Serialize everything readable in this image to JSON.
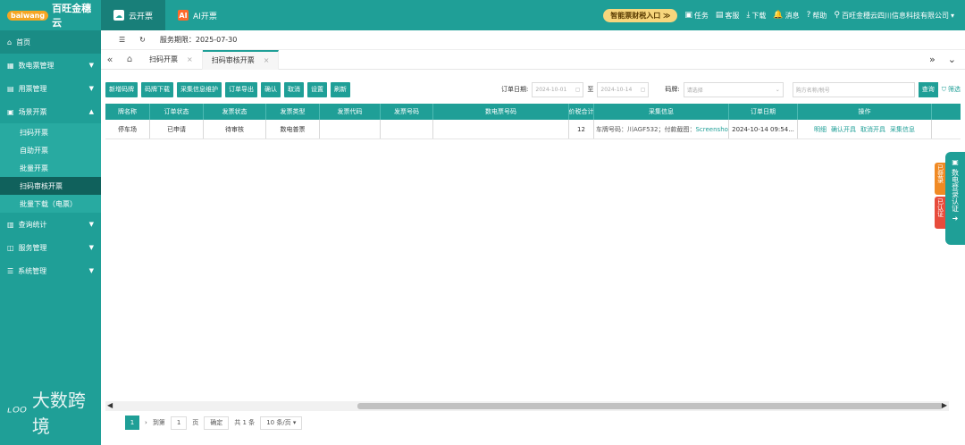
{
  "header": {
    "brand_badge": "baiwang",
    "brand_name": "百旺金穗云",
    "tabs": [
      {
        "label": "云开票"
      },
      {
        "label": "AI开票"
      }
    ],
    "promo": "智能票财税入口 ≫",
    "links": [
      "任务",
      "客服",
      "下载",
      "消息",
      "帮助"
    ],
    "company": "百旺金穗云四川信息科技有限公司"
  },
  "sidebar": {
    "items": [
      {
        "label": "首页"
      },
      {
        "label": "数电票管理"
      },
      {
        "label": "用票管理"
      },
      {
        "label": "场景开票"
      },
      {
        "label": "查询统计"
      },
      {
        "label": "服务管理"
      },
      {
        "label": "系统管理"
      }
    ],
    "sub_items": [
      {
        "label": "扫码开票"
      },
      {
        "label": "自助开票"
      },
      {
        "label": "批量开票"
      },
      {
        "label": "扫码审核开票"
      },
      {
        "label": "批量下载（电票）"
      }
    ],
    "watermark": "大数跨境"
  },
  "service": {
    "label": "服务期限：2025-07-30"
  },
  "page_tabs": [
    {
      "label": "扫码开票"
    },
    {
      "label": "扫码审核开票"
    }
  ],
  "toolbar": {
    "buttons": [
      "新增码牌",
      "码牌下载",
      "采集信息维护",
      "订单导出",
      "确认",
      "取消",
      "设置",
      "刷新"
    ],
    "order_date_label": "订单日期:",
    "date_from": "2024-10-01",
    "date_to_label": "至",
    "date_to": "2024-10-14",
    "code_label": "码牌:",
    "code_placeholder": "请选择",
    "search_placeholder": "购方名称/税号",
    "search_btn": "查询",
    "filter_btn": "筛选"
  },
  "table": {
    "headers": [
      "牌名称",
      "订单状态",
      "发票状态",
      "发票类型",
      "发票代码",
      "发票号码",
      "数电票号码",
      "价税合计",
      "采集信息",
      "订单日期",
      "操作"
    ],
    "rows": [
      {
        "name": "停车场",
        "order_status": "已申请",
        "invoice_status": "待审核",
        "invoice_type": "数电普票",
        "invoice_code": "",
        "invoice_no": "",
        "digital_no": "",
        "amount": "12",
        "collect_prefix": "车牌号码：川AGF532；付款截图：",
        "collect_link": "Screenshot_...",
        "order_date": "2024-10-14 09:54...",
        "ops": [
          "明细",
          "确认开具",
          "取消开具",
          "采集信息"
        ]
      }
    ]
  },
  "side_widget": {
    "label": "数电登录认证",
    "badge1": "已登录",
    "badge2": "已认证"
  },
  "pager": {
    "current": "1",
    "goto_label": "到第",
    "goto_value": "1",
    "page_unit": "页",
    "confirm": "确定",
    "total": "共 1 条",
    "page_size": "10 条/页"
  }
}
